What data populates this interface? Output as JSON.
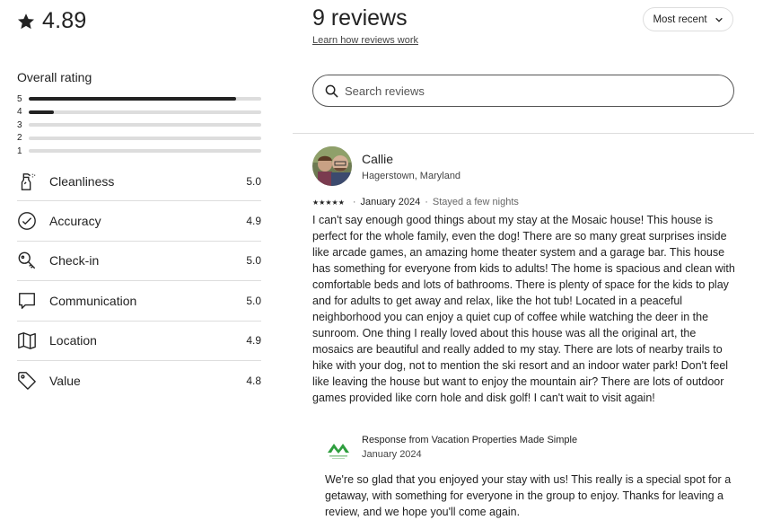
{
  "summary": {
    "score": "4.89",
    "overall_title": "Overall rating",
    "distribution": [
      {
        "label": "5",
        "fraction": 0.89
      },
      {
        "label": "4",
        "fraction": 0.11
      },
      {
        "label": "3",
        "fraction": 0
      },
      {
        "label": "2",
        "fraction": 0
      },
      {
        "label": "1",
        "fraction": 0
      }
    ],
    "categories": [
      {
        "name": "Cleanliness",
        "value": "5.0",
        "icon": "spray-bottle-icon"
      },
      {
        "name": "Accuracy",
        "value": "4.9",
        "icon": "check-circle-icon"
      },
      {
        "name": "Check-in",
        "value": "5.0",
        "icon": "key-icon"
      },
      {
        "name": "Communication",
        "value": "5.0",
        "icon": "chat-bubble-icon"
      },
      {
        "name": "Location",
        "value": "4.9",
        "icon": "map-icon"
      },
      {
        "name": "Value",
        "value": "4.8",
        "icon": "tag-icon"
      }
    ]
  },
  "reviews_header": {
    "title": "9 reviews",
    "learn_link": "Learn how reviews work",
    "sort_label": "Most recent"
  },
  "search": {
    "placeholder": "Search reviews"
  },
  "review": {
    "name": "Callie",
    "location": "Hagerstown, Maryland",
    "stars": "★★★★★",
    "date": "January 2024",
    "stay": "Stayed a few nights",
    "body": "I can't say enough good things about my stay at the Mosaic house! This house is perfect for the whole family, even the dog! There are so many great surprises inside like arcade games, an amazing home theater system and a garage bar. This house has something for everyone from kids to adults! The home is spacious and clean with comfortable beds and lots of bathrooms. There is plenty of space for the kids to play and for adults to get away and relax, like the hot tub! Located in a peaceful neighborhood you can enjoy a quiet cup of coffee while watching the deer in the sunroom. One thing I really loved about this house was all the original art, the mosaics are beautiful and really added to my stay. There are lots of nearby trails to hike with your dog, not to mention the ski resort and an indoor water park! Don't feel like leaving the house but want to enjoy the mountain air? There are lots of outdoor games provided like corn hole and disk golf! I can't wait to visit again!",
    "response": {
      "from": "Response from Vacation Properties Made Simple",
      "date": "January 2024",
      "body": "We're so glad that you enjoyed your stay with us! This really is a special spot for a getaway, with something for everyone in the group to enjoy. Thanks for leaving a review, and we hope you'll come again."
    }
  },
  "colors": {
    "text": "#222222",
    "muted": "#6a6a6a",
    "divider": "#dddddd",
    "logo_green": "#2e9e3e"
  }
}
